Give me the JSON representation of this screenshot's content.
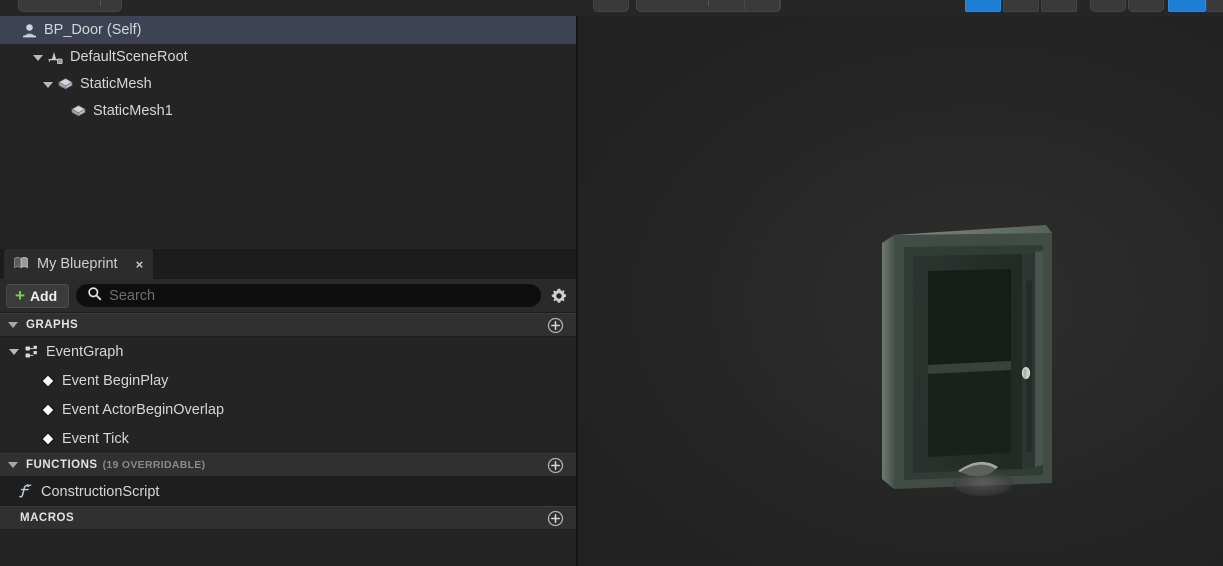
{
  "app": {
    "background_color": "#242424",
    "accent_blue": "#1d7fd4",
    "accent_green": "#72d64a",
    "selection_color": "#3d4355"
  },
  "toolbar": {
    "buttons": [
      {
        "name": "toolbar-button-left-1",
        "kind": "md"
      },
      {
        "name": "toolbar-button-left-2",
        "kind": "sm"
      },
      {
        "name": "toolbar-button-left-3",
        "kind": "sm"
      },
      {
        "name": "toolbar-button-viewport-1",
        "kind": "sm"
      },
      {
        "name": "toolbar-button-viewport-2",
        "kind": "lg"
      },
      {
        "name": "toolbar-button-viewport-3",
        "kind": "sm"
      },
      {
        "name": "toolbar-button-mode-perspective",
        "kind": "blue"
      },
      {
        "name": "toolbar-button-mode-2",
        "kind": "rect"
      },
      {
        "name": "toolbar-button-mode-3",
        "kind": "rect"
      },
      {
        "name": "toolbar-button-mode-4",
        "kind": "rect"
      },
      {
        "name": "toolbar-button-zoom-out",
        "kind": "sm"
      },
      {
        "name": "toolbar-button-zoom-in",
        "kind": "sm"
      },
      {
        "name": "toolbar-button-toggle-on",
        "kind": "blue"
      },
      {
        "name": "toolbar-button-toggle-off",
        "kind": "sm"
      }
    ]
  },
  "components_panel": {
    "rows": [
      {
        "label": "BP_Door (Self)",
        "icon": "actor-icon",
        "indent": 0,
        "twisty": "none",
        "selected": true
      },
      {
        "label": "DefaultSceneRoot",
        "icon": "scene-root-icon",
        "indent": 1,
        "twisty": "open",
        "selected": false
      },
      {
        "label": "StaticMesh",
        "icon": "static-mesh-icon",
        "indent": 2,
        "twisty": "open",
        "selected": false
      },
      {
        "label": "StaticMesh1",
        "icon": "static-mesh-icon",
        "indent": 3,
        "twisty": "none",
        "selected": false
      }
    ]
  },
  "my_blueprint": {
    "tab": {
      "label": "My Blueprint",
      "icon": "blueprint-book-icon",
      "close_label": "×"
    },
    "toolbar": {
      "add_label": "Add",
      "add_plus": "+",
      "search_placeholder": "Search",
      "search_value": "",
      "settings_icon": "gear-icon"
    },
    "sections": [
      {
        "title": "GRAPHS",
        "subtitle": "",
        "expanded": true,
        "add_icon": "plus-circle-icon",
        "items": [
          {
            "label": "EventGraph",
            "icon": "event-graph-icon",
            "indent": 1,
            "twisty": "open",
            "alt": false
          },
          {
            "label": "Event BeginPlay",
            "icon": "event-node-icon",
            "indent": 2,
            "twisty": "none",
            "alt": false
          },
          {
            "label": "Event ActorBeginOverlap",
            "icon": "event-node-icon",
            "indent": 2,
            "twisty": "none",
            "alt": false
          },
          {
            "label": "Event Tick",
            "icon": "event-node-icon",
            "indent": 2,
            "twisty": "none",
            "alt": false
          }
        ]
      },
      {
        "title": "FUNCTIONS",
        "subtitle": "(19 OVERRIDABLE)",
        "expanded": true,
        "add_icon": "plus-circle-icon",
        "items": [
          {
            "label": "ConstructionScript",
            "icon": "function-icon",
            "indent": "fn",
            "twisty": "none",
            "alt": true
          }
        ]
      },
      {
        "title": "MACROS",
        "subtitle": "",
        "expanded": false,
        "add_icon": "plus-circle-icon",
        "items": []
      }
    ]
  },
  "viewport": {
    "name": "blueprint-3d-viewport",
    "background_color": "#282828",
    "model": {
      "name": "door-mesh",
      "frame_color": "#3f4a44",
      "panel_color": "#1d231f",
      "handle_color": "#cfd3d0"
    }
  }
}
